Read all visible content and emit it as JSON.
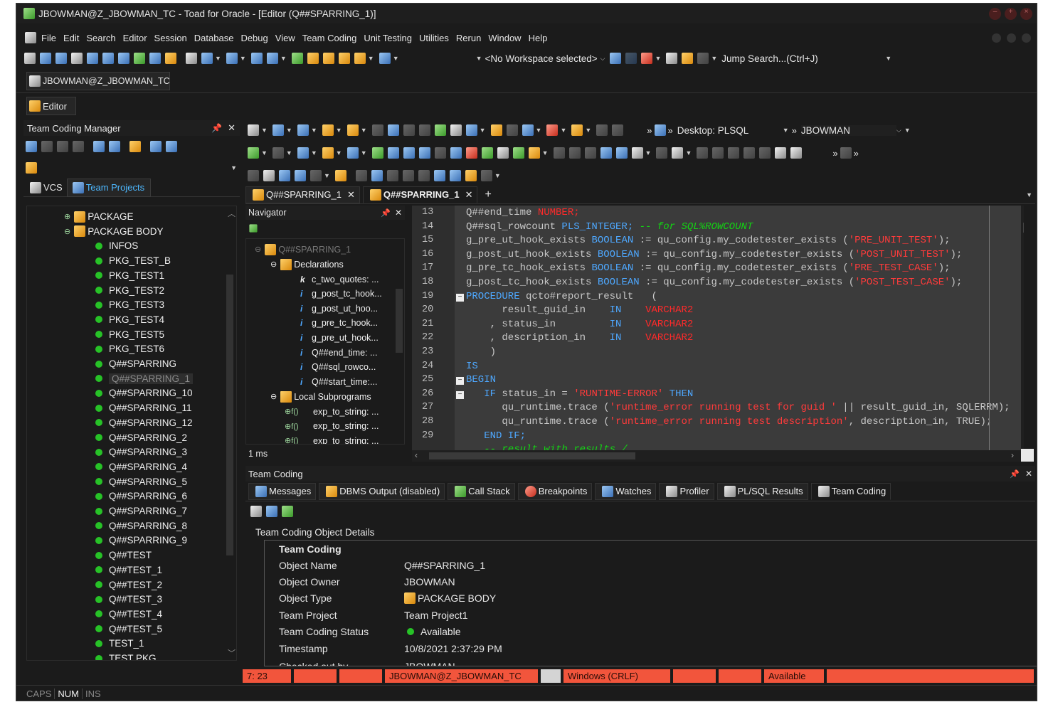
{
  "window": {
    "title": "JBOWMAN@Z_JBOWMAN_TC - Toad for Oracle - [Editor (Q##SPARRING_1)]"
  },
  "menu": [
    "File",
    "Edit",
    "Search",
    "Editor",
    "Session",
    "Database",
    "Debug",
    "View",
    "Team Coding",
    "Unit Testing",
    "Utilities",
    "Rerun",
    "Window",
    "Help"
  ],
  "toolbar": {
    "workspace": "<No Workspace selected>",
    "jump_search": "Jump Search...(Ctrl+J)"
  },
  "connection_tab": "JBOWMAN@Z_JBOWMAN_TC",
  "editor_tab": "Editor",
  "tcm": {
    "title": "Team Coding Manager",
    "tabs": [
      "VCS",
      "Team Projects"
    ],
    "items": [
      "PACKAGE",
      "PACKAGE BODY",
      "INFOS",
      "PKG_TEST_B",
      "PKG_TEST1",
      "PKG_TEST2",
      "PKG_TEST3",
      "PKG_TEST4",
      "PKG_TEST5",
      "PKG_TEST6",
      "Q##SPARRING",
      "Q##SPARRING_1",
      "Q##SPARRING_10",
      "Q##SPARRING_11",
      "Q##SPARRING_12",
      "Q##SPARRING_2",
      "Q##SPARRING_3",
      "Q##SPARRING_4",
      "Q##SPARRING_5",
      "Q##SPARRING_6",
      "Q##SPARRING_7",
      "Q##SPARRING_8",
      "Q##SPARRING_9",
      "Q##TEST",
      "Q##TEST_1",
      "Q##TEST_2",
      "Q##TEST_3",
      "Q##TEST_4",
      "Q##TEST_5",
      "TEST_1",
      "TEST PKG"
    ]
  },
  "editor": {
    "desktop": "Desktop: PLSQL",
    "schema": "JBOWMAN",
    "doc_tabs": [
      "Q##SPARRING_1",
      "Q##SPARRING_1"
    ],
    "line_numbers": [
      "13",
      "14",
      "15",
      "16",
      "17",
      "18",
      "19",
      "20",
      "21",
      "22",
      "23",
      "24",
      "25",
      "26",
      "27",
      "28",
      "29"
    ]
  },
  "navigator": {
    "title": "Navigator",
    "root": "Q##SPARRING_1",
    "declarations": "Declarations",
    "decl_items": [
      "c_two_quotes: ...",
      "g_post_tc_hook...",
      "g_post_ut_hoo...",
      "g_pre_tc_hook...",
      "g_pre_ut_hook...",
      "Q##end_time: ...",
      "Q##sql_rowco...",
      "Q##start_time:..."
    ],
    "local_subprograms": "Local Subprograms",
    "sub_items": [
      "exp_to_string: ...",
      "exp_to_string: ...",
      "exp_to_string: ..."
    ],
    "timing": "1 ms"
  },
  "bottom": {
    "title": "Team Coding",
    "tabs": [
      "Messages",
      "DBMS Output (disabled)",
      "Call Stack",
      "Breakpoints",
      "Watches",
      "Profiler",
      "PL/SQL Results",
      "Team Coding"
    ],
    "details_title": "Team Coding Object Details",
    "group": "Team Coding",
    "rows": [
      {
        "k": "Object Name",
        "v": "Q##SPARRING_1"
      },
      {
        "k": "Object Owner",
        "v": "JBOWMAN"
      },
      {
        "k": "Object Type",
        "v": "PACKAGE BODY"
      },
      {
        "k": "Team Project",
        "v": "Team Project1"
      },
      {
        "k": "Team Coding Status",
        "v": "Available"
      },
      {
        "k": "Timestamp",
        "v": "10/8/2021 2:37:29 PM"
      }
    ],
    "partial_row": {
      "k": "Checked out by",
      "v": "JBOWMAN"
    }
  },
  "statusbar": {
    "position": "7: 23",
    "connection": "JBOWMAN@Z_JBOWMAN_TC",
    "line_ending": "Windows (CRLF)",
    "status": "Available"
  },
  "keys": [
    "CAPS",
    "NUM",
    "INS"
  ],
  "colors": {
    "status_bar": "#f2553c",
    "keyword": "#4ea8ff",
    "string": "#ff3b3b",
    "comment": "#13d313"
  }
}
